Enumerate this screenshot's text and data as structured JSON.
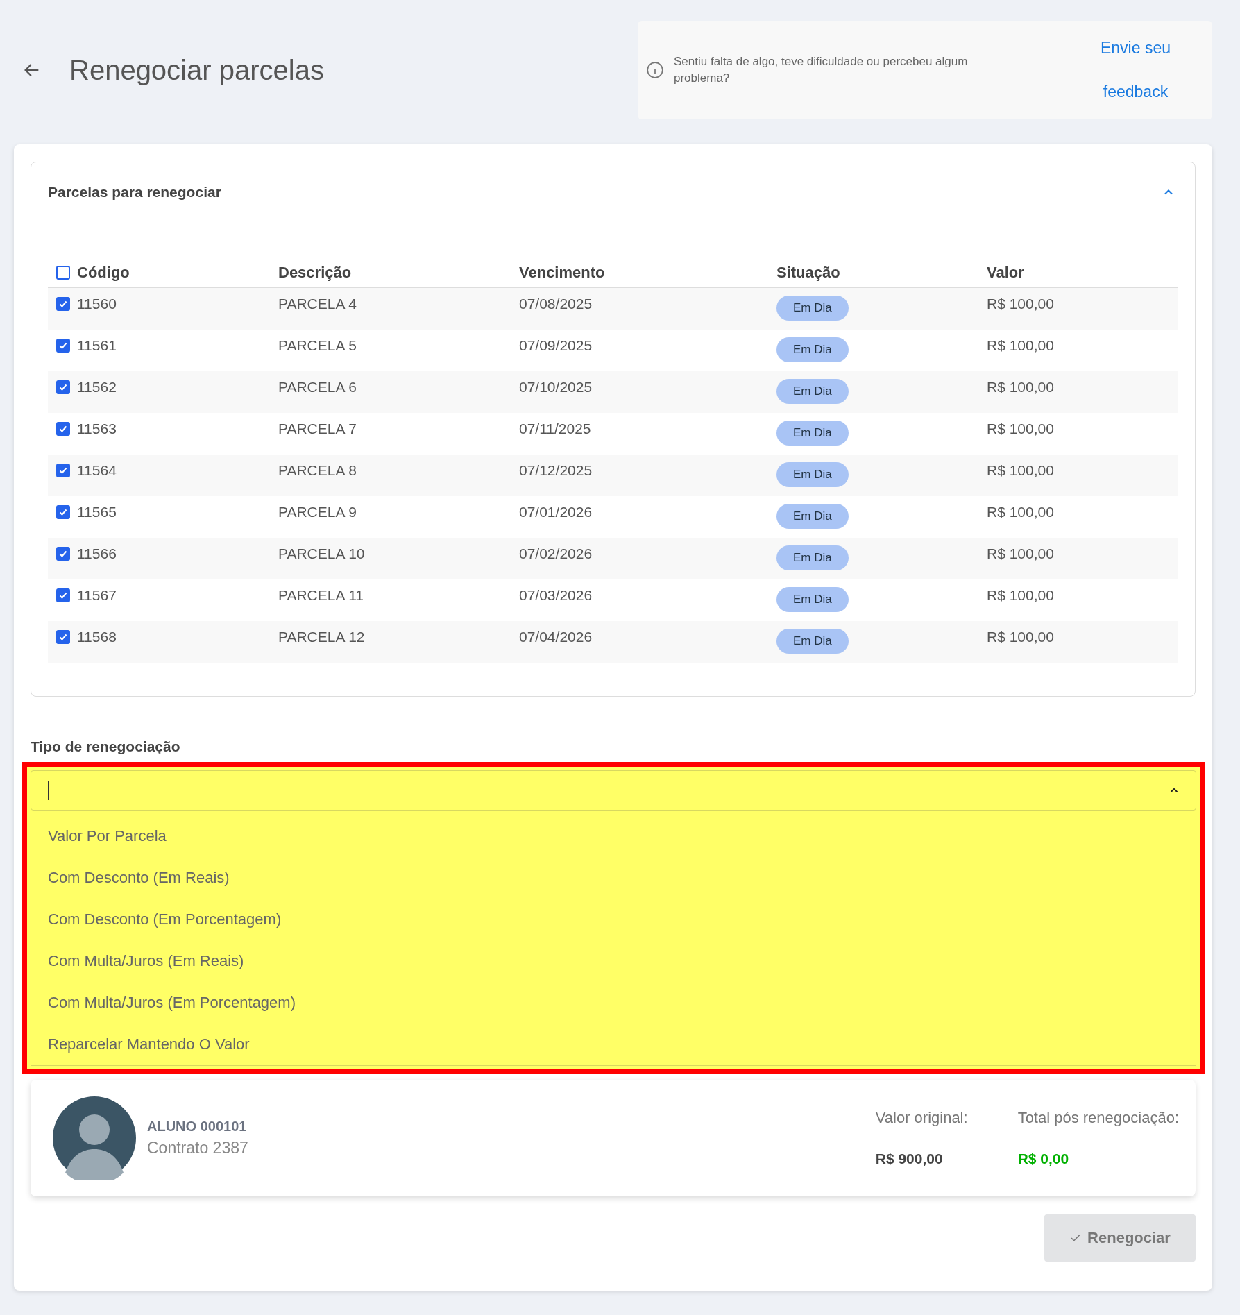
{
  "header": {
    "title": "Renegociar parcelas"
  },
  "feedback": {
    "message": "Sentiu falta de algo, teve dificuldade ou percebeu algum problema?",
    "link_line_1": "Envie seu",
    "link_line_2": "feedback"
  },
  "installments_panel": {
    "title": "Parcelas para renegociar",
    "expanded": true,
    "select_all": {
      "checked": false
    },
    "columns": [
      "Código",
      "Descrição",
      "Vencimento",
      "Situação",
      "Valor"
    ],
    "rows": [
      {
        "code": "11560",
        "description": "PARCELA 4",
        "due": "07/08/2025",
        "status": "Em Dia",
        "value": "R$ 100,00",
        "checked": true
      },
      {
        "code": "11561",
        "description": "PARCELA 5",
        "due": "07/09/2025",
        "status": "Em Dia",
        "value": "R$ 100,00",
        "checked": true
      },
      {
        "code": "11562",
        "description": "PARCELA 6",
        "due": "07/10/2025",
        "status": "Em Dia",
        "value": "R$ 100,00",
        "checked": true
      },
      {
        "code": "11563",
        "description": "PARCELA 7",
        "due": "07/11/2025",
        "status": "Em Dia",
        "value": "R$ 100,00",
        "checked": true
      },
      {
        "code": "11564",
        "description": "PARCELA 8",
        "due": "07/12/2025",
        "status": "Em Dia",
        "value": "R$ 100,00",
        "checked": true
      },
      {
        "code": "11565",
        "description": "PARCELA 9",
        "due": "07/01/2026",
        "status": "Em Dia",
        "value": "R$ 100,00",
        "checked": true
      },
      {
        "code": "11566",
        "description": "PARCELA 10",
        "due": "07/02/2026",
        "status": "Em Dia",
        "value": "R$ 100,00",
        "checked": true
      },
      {
        "code": "11567",
        "description": "PARCELA 11",
        "due": "07/03/2026",
        "status": "Em Dia",
        "value": "R$ 100,00",
        "checked": true
      },
      {
        "code": "11568",
        "description": "PARCELA 12",
        "due": "07/04/2026",
        "status": "Em Dia",
        "value": "R$ 100,00",
        "checked": true
      }
    ]
  },
  "renegotiation_type": {
    "label": "Tipo de renegociação",
    "expanded": true,
    "options": [
      {
        "label": "Valor Por Parcela",
        "selected": false
      },
      {
        "label": "Com Desconto (Em Reais)",
        "selected": false
      },
      {
        "label": "Com Desconto (Em Porcentagem)",
        "selected": false
      },
      {
        "label": "Com Multa/Juros (Em Reais)",
        "selected": false
      },
      {
        "label": "Com Multa/Juros (Em Porcentagem)",
        "selected": false
      },
      {
        "label": "Reparcelar Mantendo O Valor",
        "selected": false
      }
    ]
  },
  "summary": {
    "student": "ALUNO 000101",
    "contract": "Contrato 2387",
    "original_label": "Valor original:",
    "original_value": "R$ 900,00",
    "total_label": "Total pós renegociação:",
    "total_value": "R$ 0,00"
  },
  "actions": {
    "renegotiate": {
      "label": "Renegociar",
      "disabled": true
    }
  }
}
